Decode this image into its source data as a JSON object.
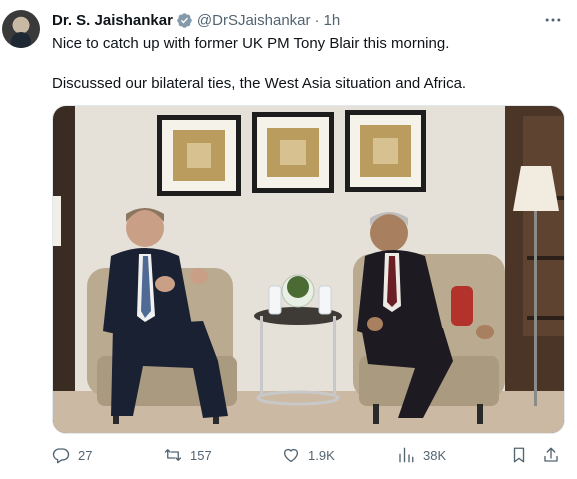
{
  "tweet": {
    "author_name": "Dr. S. Jaishankar",
    "handle": "@DrSJaishankar",
    "separator": "·",
    "time": "1h",
    "text_line1": "Nice to catch up with former UK PM Tony Blair this morning.",
    "text_line2": "Discussed our bilateral ties, the West Asia situation and Africa."
  },
  "icons": {
    "verified": "verified-badge-icon",
    "more": "more-horizontal-icon",
    "reply": "reply-icon",
    "retweet": "retweet-icon",
    "like": "heart-icon",
    "views": "views-chart-icon",
    "bookmark": "bookmark-icon",
    "share": "share-icon"
  },
  "stats": {
    "replies": "27",
    "retweets": "157",
    "likes": "1.9K",
    "views": "38K"
  },
  "colors": {
    "text": "#0f1419",
    "secondary": "#536471",
    "verified": "#829aab"
  }
}
